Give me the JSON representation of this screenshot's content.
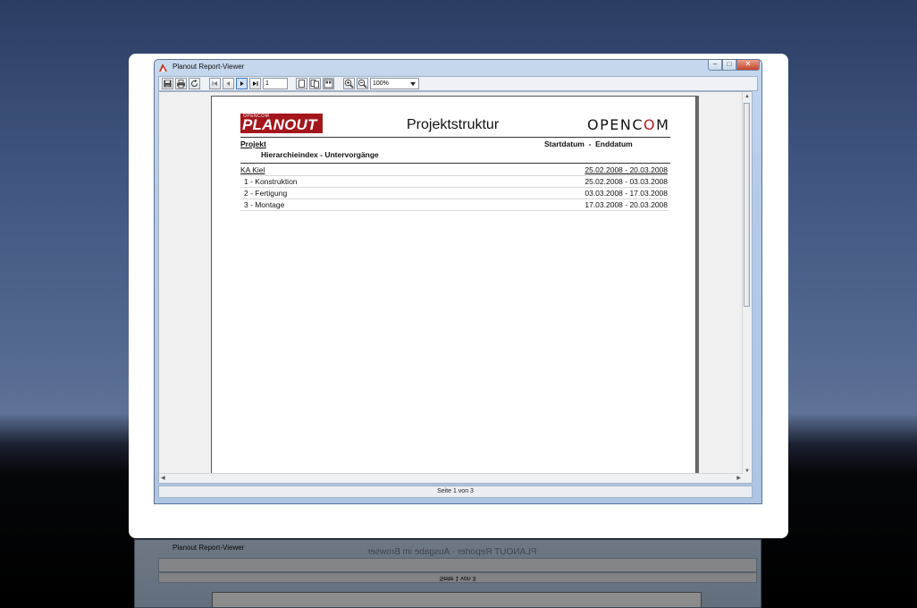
{
  "window": {
    "title": "Planout Report-Viewer",
    "controls": {
      "minimize": "–",
      "maximize": "□",
      "close": "✕"
    }
  },
  "toolbar": {
    "page_value": "1",
    "zoom_value": "100%",
    "icons": [
      "save-icon",
      "print-icon",
      "refresh-icon",
      "first-page-icon",
      "prev-page-icon",
      "next-page-icon",
      "last-page-icon",
      "single-page-icon",
      "two-pages-icon",
      "multi-page-icon",
      "zoom-in-icon",
      "zoom-out-icon"
    ]
  },
  "report": {
    "brand_left_small": "OPENCOM",
    "brand_left_big": "PLANOUT",
    "title": "Projektstruktur",
    "brand_right_pre": "OPENC",
    "brand_right_o": "O",
    "brand_right_post": "M",
    "header_project": "Projekt",
    "header_sub": "Hierarchieindex - Untervorgänge",
    "header_dates": "Startdatum  -  Enddatum",
    "rows": [
      {
        "name": "KA Kiel",
        "dates": "25.02.2008 - 20.03.2008"
      },
      {
        "name": "1 - Konstruktion",
        "dates": "25.02.2008 - 03.03.2008"
      },
      {
        "name": "2 - Fertigung",
        "dates": "03.03.2008 - 17.03.2008"
      },
      {
        "name": "3 - Montage",
        "dates": "17.03.2008 - 20.03.2008"
      }
    ]
  },
  "status": {
    "page_info": "Seite 1 von 3"
  },
  "reflection": {
    "title": "Planout Report-Viewer",
    "status": "Seite 1 von 3",
    "ghost": "PLANOUT Reporter - Ausgabe im Browser"
  },
  "colors": {
    "brand_red": "#a3161c",
    "accent_blue": "#3a78c7"
  }
}
